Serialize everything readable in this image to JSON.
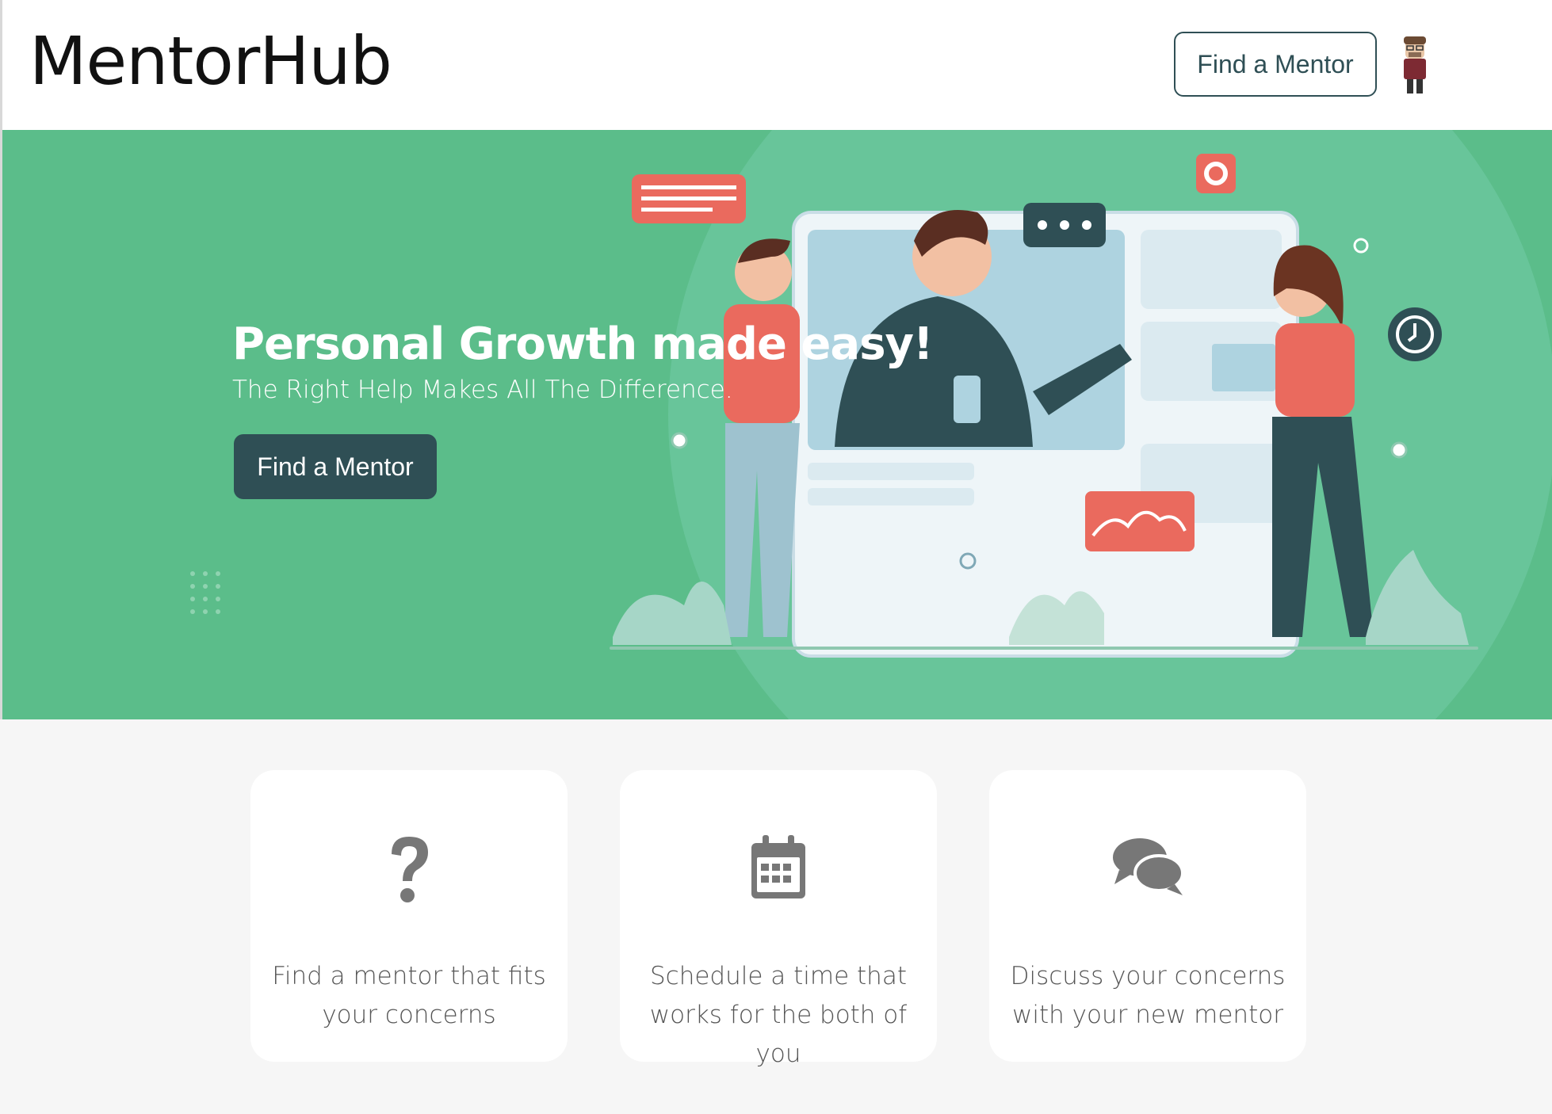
{
  "header": {
    "logo": "MentorHub",
    "find_mentor_label": "Find a Mentor"
  },
  "hero": {
    "title": "Personal Growth made easy!",
    "subtitle": "The Right Help Makes All The Difference.",
    "cta_label": "Find a Mentor"
  },
  "features": [
    {
      "icon": "question-icon",
      "text": "Find a mentor that fits your concerns"
    },
    {
      "icon": "calendar-icon",
      "text": "Schedule a time that works for the both of you"
    },
    {
      "icon": "chat-bubbles-icon",
      "text": "Discuss your concerns with your new mentor"
    }
  ],
  "colors": {
    "hero_bg": "#5bbd8a",
    "primary_dark": "#2f4f55",
    "accent_red": "#ea6a5e",
    "icon_gray": "#777777"
  }
}
